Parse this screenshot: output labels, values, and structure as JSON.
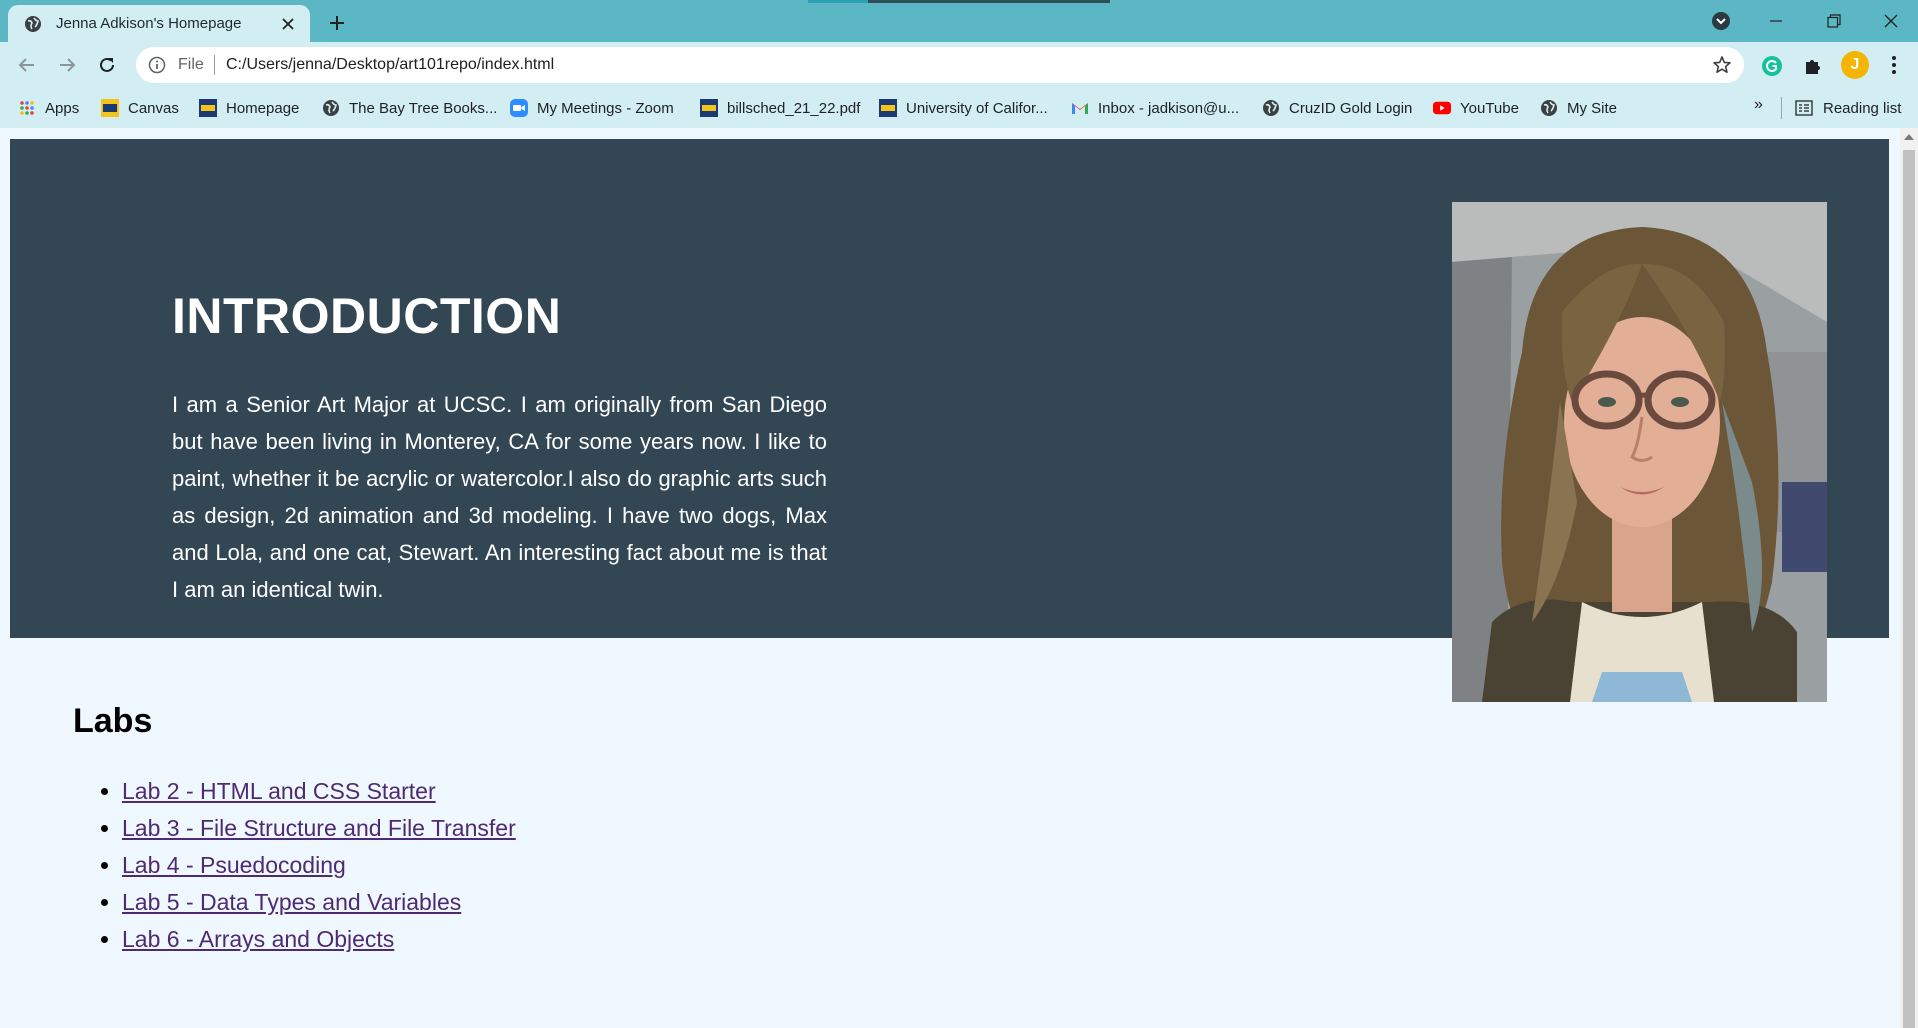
{
  "browser": {
    "tab_title": "Jenna Adkison's Homepage",
    "url_scheme": "File",
    "url": "C:/Users/jenna/Desktop/art101repo/index.html",
    "profile_initial": "J"
  },
  "bookmarks": [
    {
      "label": "Apps",
      "icon": "apps-grid-icon"
    },
    {
      "label": "Canvas",
      "icon": "ucsc-icon"
    },
    {
      "label": "Homepage",
      "icon": "ucsc-icon"
    },
    {
      "label": "The Bay Tree Books...",
      "icon": "globe-icon"
    },
    {
      "label": "My Meetings - Zoom",
      "icon": "zoom-icon"
    },
    {
      "label": "billsched_21_22.pdf",
      "icon": "ucsc-icon"
    },
    {
      "label": "University of Califor...",
      "icon": "ucsc-icon"
    },
    {
      "label": "Inbox - jadkison@u...",
      "icon": "gmail-icon"
    },
    {
      "label": "CruzID Gold Login",
      "icon": "globe-icon"
    },
    {
      "label": "YouTube",
      "icon": "youtube-icon"
    },
    {
      "label": "My Site",
      "icon": "globe-icon"
    }
  ],
  "bookmarks_more": "»",
  "reading_list": "Reading list",
  "page": {
    "intro_heading": "INTRODUCTION",
    "intro_text": "I am a Senior Art Major at UCSC. I am originally from San Diego but have been living in Monterey, CA for some years now. I like to paint, whether it be acrylic or watercolor.I also do graphic arts such as design, 2d animation and 3d modeling. I have two dogs, Max and Lola, and one cat, Stewart. An interesting fact about me is that I am an identical twin.",
    "labs_heading": "Labs",
    "labs": [
      "Lab 2 - HTML and CSS Starter",
      "Lab 3 - File Structure and File Transfer",
      "Lab 4 - Psuedocoding",
      "Lab 5 - Data Types and Variables",
      "Lab 6 - Arrays and Objects"
    ]
  },
  "colors": {
    "tab_strip": "#5bb7c3",
    "toolbar": "#d3eef2",
    "intro_bg": "#324654",
    "page_bg": "#f0f8ff",
    "link": "#4e2a72"
  }
}
